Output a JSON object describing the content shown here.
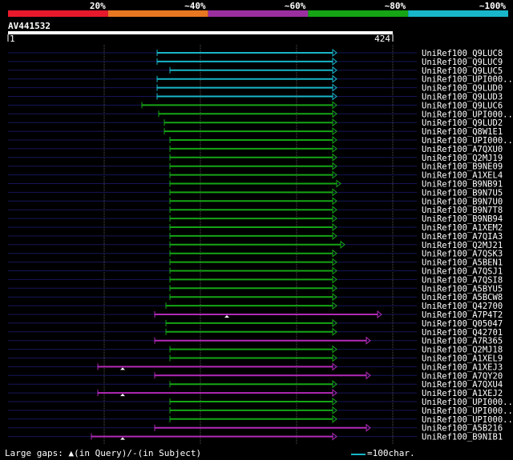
{
  "legend": {
    "labels": [
      "20%",
      "~40%",
      "~60%",
      "~80%",
      "~100%"
    ],
    "colors": [
      "#e8192c",
      "#e87722",
      "#9b2fa0",
      "#15a515",
      "#18b6c8"
    ]
  },
  "query": {
    "name": "AV441532",
    "start": "1",
    "end": "424"
  },
  "scale_bar_label": "=100char.",
  "footer_gaps_text": "Large gaps:",
  "footer_in_query": "(in Query)/",
  "footer_in_subject": "(in Subject)",
  "hits": [
    {
      "label": "UniRef100_Q9LUC8",
      "color": "cyan",
      "start": 196,
      "end": 415,
      "bg": 0
    },
    {
      "label": "UniRef100_Q9LUC9",
      "color": "cyan",
      "start": 196,
      "end": 415,
      "bg": 0
    },
    {
      "label": "UniRef100_Q9LUC5",
      "color": "cyan",
      "start": 212,
      "end": 415,
      "bg": 0
    },
    {
      "label": "UniRef100_UPI000..",
      "color": "cyan",
      "start": 196,
      "end": 415,
      "bg": 0
    },
    {
      "label": "UniRef100_Q9LUD0",
      "color": "cyan",
      "start": 196,
      "end": 415,
      "bg": 0
    },
    {
      "label": "UniRef100_Q9LUD3",
      "color": "cyan",
      "start": 196,
      "end": 415,
      "bg": 0
    },
    {
      "label": "UniRef100_Q9LUC6",
      "color": "green",
      "start": 177,
      "end": 415,
      "bg": 0
    },
    {
      "label": "UniRef100_UPI000..",
      "color": "green",
      "start": 198,
      "end": 415,
      "bg": 0
    },
    {
      "label": "UniRef100_Q9LUD2",
      "color": "green",
      "start": 205,
      "end": 415,
      "bg": 0
    },
    {
      "label": "UniRef100_Q8W1E1",
      "color": "green",
      "start": 205,
      "end": 415,
      "bg": 0
    },
    {
      "label": "UniRef100_UPI000..",
      "color": "green",
      "start": 212,
      "end": 415,
      "bg": 0
    },
    {
      "label": "UniRef100_A7QXU0",
      "color": "green",
      "start": 212,
      "end": 415,
      "bg": 0
    },
    {
      "label": "UniRef100_Q2MJ19",
      "color": "green",
      "start": 212,
      "end": 415,
      "bg": 0
    },
    {
      "label": "UniRef100_B9NE09",
      "color": "green",
      "start": 212,
      "end": 415,
      "bg": 0
    },
    {
      "label": "UniRef100_A1XEL4",
      "color": "green",
      "start": 212,
      "end": 415,
      "bg": 0
    },
    {
      "label": "UniRef100_B9NB91",
      "color": "green",
      "start": 212,
      "end": 420,
      "bg": 0
    },
    {
      "label": "UniRef100_B9N7U5",
      "color": "green",
      "start": 212,
      "end": 415,
      "bg": 0
    },
    {
      "label": "UniRef100_B9N7U0",
      "color": "green",
      "start": 212,
      "end": 415,
      "bg": 0
    },
    {
      "label": "UniRef100_B9N7T8",
      "color": "green",
      "start": 212,
      "end": 415,
      "bg": 0
    },
    {
      "label": "UniRef100_B9NB94",
      "color": "green",
      "start": 212,
      "end": 415,
      "bg": 0
    },
    {
      "label": "UniRef100_A1XEM2",
      "color": "green",
      "start": 212,
      "end": 415,
      "bg": 0
    },
    {
      "label": "UniRef100_A7QIA3",
      "color": "green",
      "start": 212,
      "end": 415,
      "bg": 0
    },
    {
      "label": "UniRef100_Q2MJ21",
      "color": "green",
      "start": 212,
      "end": 425,
      "bg": 0
    },
    {
      "label": "UniRef100_A7QSK3",
      "color": "green",
      "start": 212,
      "end": 415,
      "bg": 0
    },
    {
      "label": "UniRef100_A5BEN1",
      "color": "green",
      "start": 212,
      "end": 415,
      "bg": 0
    },
    {
      "label": "UniRef100_A7QSJ1",
      "color": "green",
      "start": 212,
      "end": 415,
      "bg": 0
    },
    {
      "label": "UniRef100_A7QSI8",
      "color": "green",
      "start": 212,
      "end": 415,
      "bg": 0
    },
    {
      "label": "UniRef100_A5BYU5",
      "color": "green",
      "start": 212,
      "end": 415,
      "bg": 0
    },
    {
      "label": "UniRef100_A5BCW8",
      "color": "green",
      "start": 212,
      "end": 415,
      "bg": 0
    },
    {
      "label": "UniRef100_Q42700",
      "color": "green",
      "start": 207,
      "end": 415,
      "bg": 0
    },
    {
      "label": "UniRef100_A7P4T2",
      "color": "purple",
      "start": 193,
      "end": 471,
      "bg": 1,
      "gap": 280
    },
    {
      "label": "UniRef100_Q05047",
      "color": "green",
      "start": 207,
      "end": 415,
      "bg": 0
    },
    {
      "label": "UniRef100_Q42701",
      "color": "green",
      "start": 207,
      "end": 415,
      "bg": 0
    },
    {
      "label": "UniRef100_A7R365",
      "color": "purple",
      "start": 193,
      "end": 457,
      "bg": 1
    },
    {
      "label": "UniRef100_Q2MJ18",
      "color": "green",
      "start": 212,
      "end": 415,
      "bg": 0
    },
    {
      "label": "UniRef100_A1XEL9",
      "color": "green",
      "start": 212,
      "end": 415,
      "bg": 0
    },
    {
      "label": "UniRef100_A1XEJ3",
      "color": "purple",
      "start": 122,
      "end": 415,
      "bg": 1,
      "gap": 150
    },
    {
      "label": "UniRef100_A7QY20",
      "color": "purple",
      "start": 193,
      "end": 457,
      "bg": 1
    },
    {
      "label": "UniRef100_A7QXU4",
      "color": "green",
      "start": 212,
      "end": 415,
      "bg": 0
    },
    {
      "label": "UniRef100_A1XEJ2",
      "color": "purple",
      "start": 122,
      "end": 415,
      "bg": 1,
      "gap": 150
    },
    {
      "label": "UniRef100_UPI000..",
      "color": "green",
      "start": 212,
      "end": 415,
      "bg": 0
    },
    {
      "label": "UniRef100_UPI000..",
      "color": "green",
      "start": 212,
      "end": 415,
      "bg": 0
    },
    {
      "label": "UniRef100_UPI000..",
      "color": "green",
      "start": 212,
      "end": 415,
      "bg": 0
    },
    {
      "label": "UniRef100_A5B216",
      "color": "purple",
      "start": 193,
      "end": 457,
      "bg": 1
    },
    {
      "label": "UniRef100_B9NIB1",
      "color": "purple",
      "start": 114,
      "end": 415,
      "bg": 1,
      "gap": 150
    }
  ]
}
